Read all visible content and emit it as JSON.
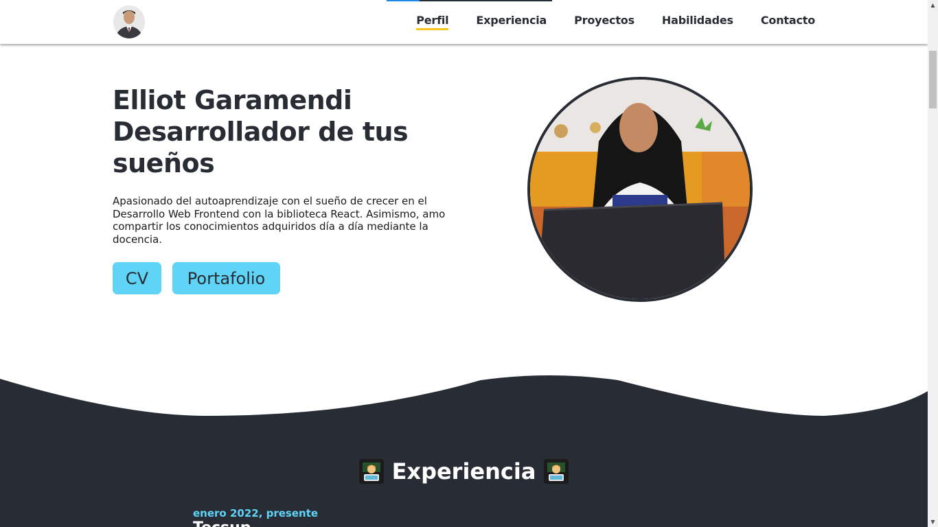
{
  "header": {
    "progress_percent": 20,
    "nav": [
      {
        "label": "Perfil",
        "active": true
      },
      {
        "label": "Experiencia",
        "active": false
      },
      {
        "label": "Proyectos",
        "active": false
      },
      {
        "label": "Habilidades",
        "active": false
      },
      {
        "label": "Contacto",
        "active": false
      }
    ]
  },
  "hero": {
    "title_line1": "Elliot Garamendi",
    "title_line2": "Desarrollador de tus",
    "title_line3": "sueños",
    "description": "Apasionado del autoaprendizaje con el sueño de crecer en el Desarrollo Web Frontend con la biblioteca React. Asimismo, amo compartir los conocimientos adquiridos día a día mediante la docencia.",
    "buttons": {
      "cv": "CV",
      "portfolio": "Portafolio"
    }
  },
  "experience": {
    "title": "Experiencia",
    "emoji": "technologist-icon",
    "items": [
      {
        "date": "enero 2022, presente",
        "company": "Tecsup"
      }
    ]
  },
  "colors": {
    "dark": "#282c34",
    "accent": "#5fd4f7",
    "active_underline": "#f5c518"
  }
}
